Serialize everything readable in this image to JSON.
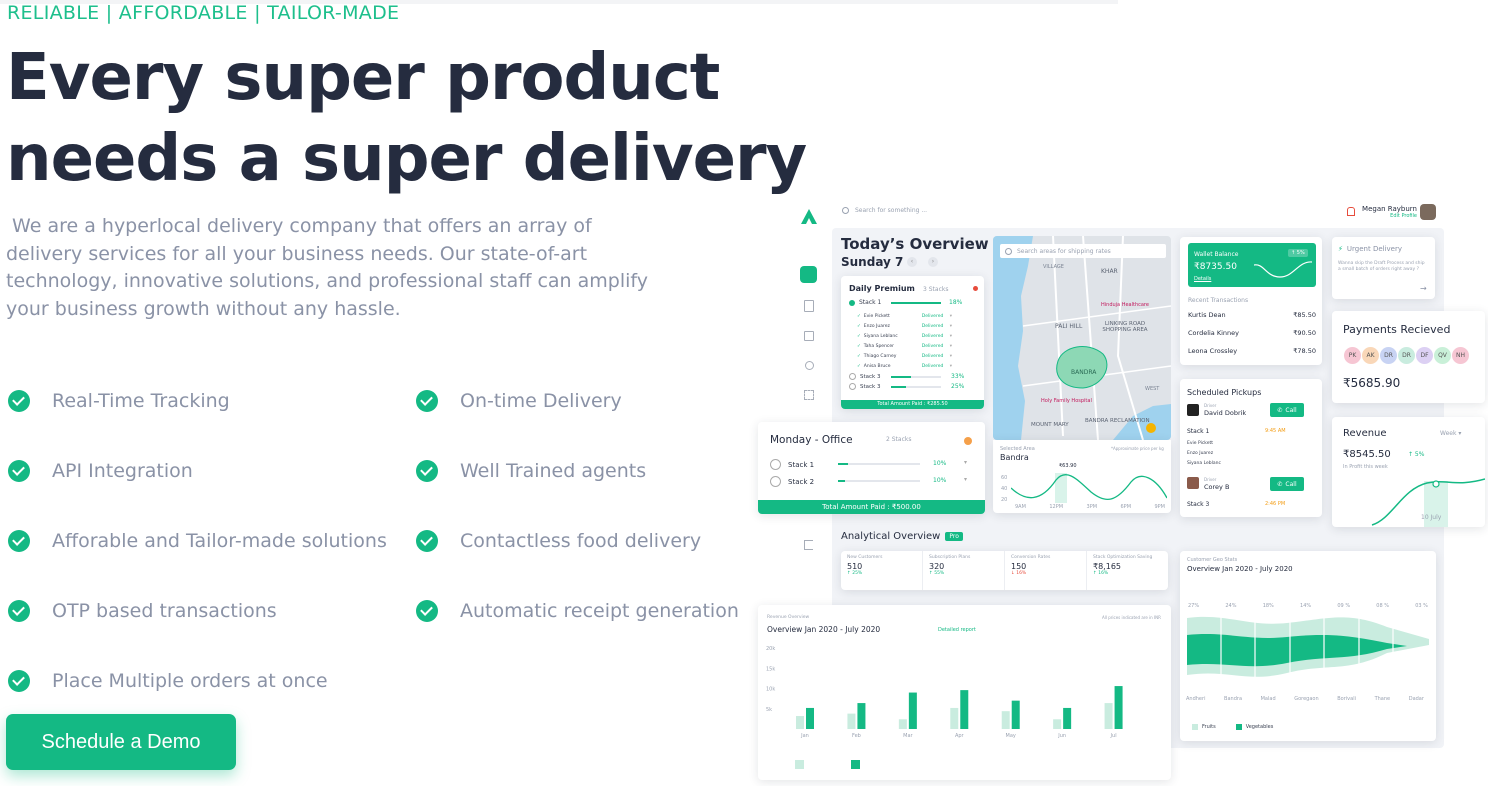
{
  "tagline": "RELIABLE | AFFORDABLE | TAILOR-MADE",
  "hero": {
    "line1": "Every super product",
    "line2": "needs a super delivery"
  },
  "description": " We are a hyperlocal delivery company that offers an array of delivery services for all your business needs. Our state-of-art technology, innovative solutions, and professional staff can amplify your business growth without any hassle.",
  "features": {
    "left": [
      "Real-Time Tracking",
      "API Integration",
      "Afforable and Tailor-made solutions",
      "OTP based transactions",
      "Place Multiple orders at once"
    ],
    "right": [
      "On-time Delivery",
      "Well Trained agents",
      "Contactless food delivery",
      "Automatic receipt generation"
    ]
  },
  "cta": "Schedule a Demo",
  "colors": {
    "accent": "#14b984",
    "text_dark": "#252c3f",
    "text_muted": "#8a92a6"
  },
  "dashboard": {
    "search_placeholder": "Search for something ...",
    "user": {
      "name": "Megan Rayburn",
      "link": "Edit Profile"
    },
    "overview_title": "Today’s Overview",
    "date": "Sunday 7",
    "daily_premium": {
      "title": "Daily Premium",
      "stacks": "3 Stacks",
      "stack1": "Stack 1",
      "stack1_pct": "18%",
      "agents": [
        "Evie Pickett",
        "Enzo Juarez",
        "Siyana Leblanc",
        "Taha Spencer",
        "Thiago Carney",
        "Anisa Bruce"
      ],
      "status": "Delivered",
      "stack3a": "Stack 3",
      "stack3a_pct": "33%",
      "stack3b": "Stack 3",
      "stack3b_pct": "25%",
      "footer": "Total Amount Paid : ₹285.50"
    },
    "monday": {
      "title": "Monday - Office",
      "stacks": "2 Stacks",
      "stack1": "Stack 1",
      "stack1_pct": "10%",
      "stack2": "Stack 2",
      "stack2_pct": "10%",
      "footer": "Total Amount Paid : ₹500.00"
    },
    "map": {
      "search": "Search areas for shipping rates",
      "labels": [
        "VILLAGE",
        "KHAR",
        "PALI HILL",
        "LINKING ROAD SHOPPING AREA",
        "BANDRA",
        "Hinduja Healthcare",
        "Holy Family Hospital",
        "MOUNT MARY",
        "BANDRA RECLAMATION",
        "WEST"
      ],
      "selected_area_label": "Selected Area",
      "selected_area": "Bandra",
      "approx": "*Approximate price per kg",
      "price": "₹63.90",
      "yticks": [
        "60",
        "40",
        "20"
      ],
      "xticks": [
        "9AM",
        "12PM",
        "3PM",
        "6PM",
        "9PM"
      ]
    },
    "wallet": {
      "label": "Wallet Balance",
      "change": "↑ 5%",
      "amount": "₹8735.50",
      "link": "Details",
      "recent": "Recent Transactions",
      "transactions": [
        {
          "name": "Kurtis Dean",
          "amount": "₹85.50"
        },
        {
          "name": "Cordelia Kinney",
          "amount": "₹90.50"
        },
        {
          "name": "Leona Crossley",
          "amount": "₹78.50"
        }
      ]
    },
    "urgent": {
      "title": "Urgent Delivery",
      "text": "Wanna skip the Draft Process and ship a small batch of orders right away ?"
    },
    "payments": {
      "title": "Payments Recieved",
      "avatars": [
        "PK",
        "AK",
        "DR",
        "DR",
        "DF",
        "QV",
        "NH"
      ],
      "amount": "₹5685.90"
    },
    "pickups": {
      "title": "Scheduled Pickups",
      "p1": {
        "label": "Driver",
        "name": "David Dobrik",
        "call": "Call",
        "stack": "Stack 1",
        "time": "9:45 AM",
        "people": [
          "Evie Pickett",
          "Enzo Juarez",
          "Siyana Leblanc"
        ]
      },
      "p2": {
        "label": "Driver",
        "name": "Corey B",
        "call": "Call",
        "stack": "Stack 3",
        "time": "2:46 PM"
      }
    },
    "revenue_card": {
      "title": "Revenue",
      "period": "Week",
      "amount": "₹8545.50",
      "change": "↑ 5%",
      "sub": "In Profit this week",
      "date": "10 July"
    },
    "analytical": {
      "title": "Analytical Overview",
      "badge": "Pro",
      "stats": [
        {
          "label": "New Customers",
          "value": "510",
          "change": "↑ 25%",
          "up": true
        },
        {
          "label": "Subscription Plans",
          "value": "320",
          "change": "↑ 55%",
          "up": true
        },
        {
          "label": "Conversion Rates",
          "value": "150",
          "change": "↓ 16%",
          "up": false
        },
        {
          "label": "Stack Optimization Saving",
          "value": "₹8,165",
          "change": "↑ 16%",
          "up": true
        }
      ]
    },
    "geo": {
      "label": "Customer Geo Stats",
      "title": "Overview Jan 2020 - July 2020",
      "percents": [
        "27%",
        "24%",
        "18%",
        "14%",
        "09 %",
        "08 %",
        "03 %"
      ],
      "areas": [
        "Andheri",
        "Bandra",
        "Malad",
        "Goregaon",
        "Borivali",
        "Thane",
        "Dadar"
      ],
      "legend": [
        "Fruits",
        "Vegetables"
      ]
    },
    "revenue_overview": {
      "label": "Revenue Overview",
      "title": "Overview Jan 2020 - July 2020",
      "link": "Detailed report",
      "note": "All prices indicated are in INR"
    }
  },
  "chart_data": {
    "type": "bar",
    "categories": [
      "Jan",
      "Feb",
      "Mar",
      "Apr",
      "May",
      "Jun",
      "Jul"
    ],
    "yticks": [
      "20k",
      "15k",
      "10k",
      "5k"
    ],
    "ylim": [
      0,
      20000
    ],
    "series": [
      {
        "values": [
          3200,
          3800,
          2400,
          5200,
          4400,
          2400,
          6400
        ],
        "color": "#c9ecdf"
      },
      {
        "values": [
          5200,
          6400,
          9000,
          9600,
          7000,
          5200,
          10600
        ],
        "color": "#14b984"
      }
    ]
  }
}
